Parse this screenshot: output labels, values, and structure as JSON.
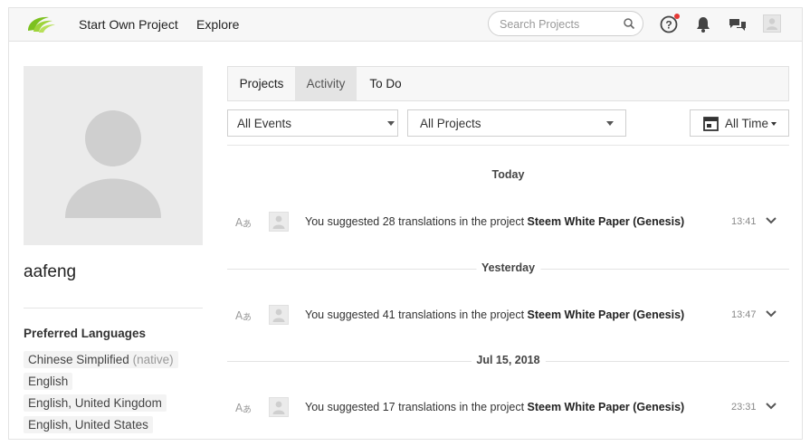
{
  "header": {
    "nav": [
      "Start Own Project",
      "Explore"
    ],
    "search_placeholder": "Search Projects",
    "icons": [
      "logo-icon",
      "search-icon",
      "help-icon",
      "notification-bell-icon",
      "messages-icon",
      "user-avatar-icon"
    ],
    "accent_color": "#7cc11f",
    "notification_dot_color": "#e53935"
  },
  "profile": {
    "username": "aafeng",
    "preferred_languages_title": "Preferred Languages",
    "languages": [
      {
        "name": "Chinese Simplified",
        "note": "(native)"
      },
      {
        "name": "English",
        "note": ""
      },
      {
        "name": "English, United Kingdom",
        "note": ""
      },
      {
        "name": "English, United States",
        "note": ""
      }
    ]
  },
  "tabs": [
    {
      "label": "Projects",
      "active": false
    },
    {
      "label": "Activity",
      "active": true
    },
    {
      "label": "To Do",
      "active": false
    }
  ],
  "filters": {
    "events": "All Events",
    "projects": "All Projects",
    "time": "All Time"
  },
  "activity": [
    {
      "day": "Today",
      "text": "You suggested 28 translations in the project ",
      "project": "Steem White Paper (Genesis)",
      "time": "13:41"
    },
    {
      "day": "Yesterday",
      "text": "You suggested 41 translations in the project ",
      "project": "Steem White Paper (Genesis)",
      "time": "13:47"
    },
    {
      "day": "Jul 15, 2018",
      "text": "You suggested 17 translations in the project ",
      "project": "Steem White Paper (Genesis)",
      "time": "23:31"
    }
  ]
}
